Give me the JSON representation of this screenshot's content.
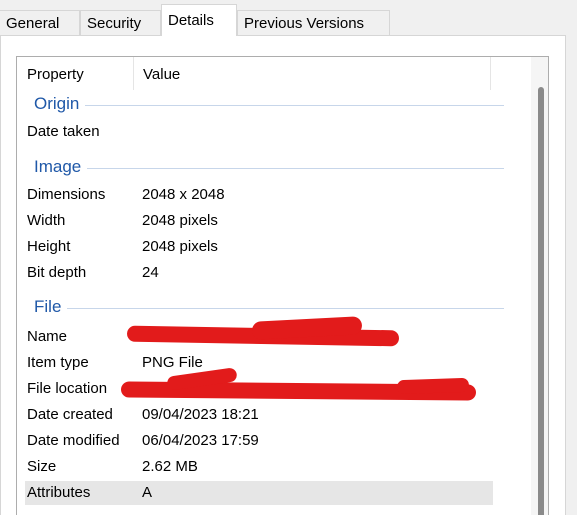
{
  "tabs": {
    "general": "General",
    "security": "Security",
    "details": "Details",
    "previous": "Previous Versions"
  },
  "columns": {
    "property": "Property",
    "value": "Value"
  },
  "groups": {
    "origin": "Origin",
    "image": "Image",
    "file": "File"
  },
  "origin_rows": [
    {
      "property": "Date taken",
      "value": ""
    }
  ],
  "image_rows": [
    {
      "property": "Dimensions",
      "value": "2048 x 2048"
    },
    {
      "property": "Width",
      "value": "2048 pixels"
    },
    {
      "property": "Height",
      "value": "2048 pixels"
    },
    {
      "property": "Bit depth",
      "value": "24"
    }
  ],
  "file_rows": [
    {
      "property": "Name",
      "value": ""
    },
    {
      "property": "Item type",
      "value": "PNG File"
    },
    {
      "property": "File location",
      "value": ""
    },
    {
      "property": "Date created",
      "value": "09/04/2023 18:21"
    },
    {
      "property": "Date modified",
      "value": "06/04/2023 17:59"
    },
    {
      "property": "Size",
      "value": "2.62 MB"
    },
    {
      "property": "Attributes",
      "value": "A"
    }
  ],
  "colors": {
    "group_label": "#1f58a8",
    "redaction": "#e21b1b",
    "selected_row": "#e6e6e6"
  }
}
